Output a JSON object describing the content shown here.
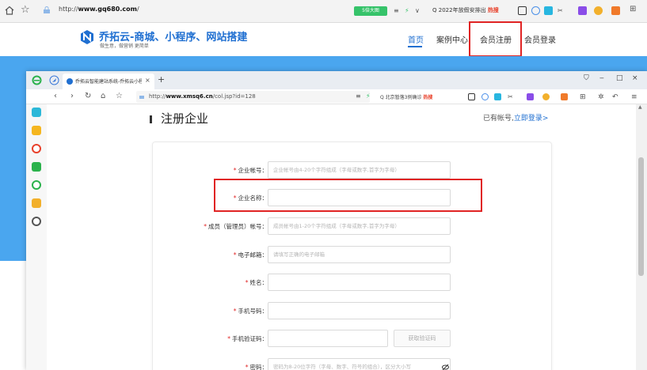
{
  "outer_browser": {
    "url_prefix": "http://",
    "url_host": "www.gq680.com",
    "url_suffix": "/",
    "zoom_badge": "5倍大图",
    "search_text": "2022年放假安排出",
    "hot_label": "热搜"
  },
  "site": {
    "logo_title": "乔拓云-商城、小程序、网站搭建",
    "logo_slogan": "做生意，做营销 更简单",
    "nav": [
      "首页",
      "案例中心",
      "会员注册",
      "会员登录"
    ],
    "active_nav": "首页",
    "highlighted_nav": "会员注册"
  },
  "inner_browser": {
    "tab_title": "乔拓云智能建站系统-乔拓云小程",
    "tab_close": "×",
    "new_tab": "+",
    "url_prefix": "http://",
    "url_host": "www.xmsq6.cn",
    "url_path": "/col.jsp?id=128",
    "search_text": "北京暂落3例确诊",
    "hot_label": "热搜",
    "window_controls": [
      "‒",
      "□",
      "×"
    ]
  },
  "register": {
    "title": "注册企业",
    "have_account": "已有帐号,",
    "login_link": "立即登录>",
    "fields": [
      {
        "label": "企业帐号",
        "placeholder": "企业帐号由4-20个字符组成（字母或数字,首字为字母）",
        "required": true
      },
      {
        "label": "企业名称",
        "placeholder": "",
        "required": true
      },
      {
        "label": "成员（管理员）帐号",
        "placeholder": "成员帐号由1-20个字符组成（字母或数字,首字为字母）",
        "required": true
      },
      {
        "label": "电子邮箱",
        "placeholder": "请填写正确的电子邮箱",
        "required": true
      },
      {
        "label": "姓名",
        "placeholder": "",
        "required": true
      },
      {
        "label": "手机号码",
        "placeholder": "",
        "required": true
      },
      {
        "label": "手机验证码",
        "placeholder": "",
        "required": true
      },
      {
        "label": "密码",
        "placeholder": "密码为8-20位字符（字母、数字、符号的组合），区分大小写",
        "required": true
      }
    ],
    "get_code_button": "获取验证码"
  },
  "colors": {
    "brand_blue": "#1f6fd1",
    "band_blue": "#4aa6ef",
    "highlight_red": "#e02424",
    "required_red": "#e02424"
  }
}
